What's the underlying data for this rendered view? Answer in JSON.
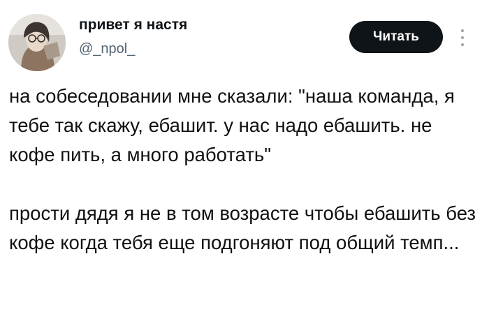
{
  "author": {
    "display_name": "привет я настя",
    "handle": "@_npol_"
  },
  "actions": {
    "read_label": "Читать",
    "more_icon": "more-vertical-icon"
  },
  "tweet": {
    "paragraphs": [
      "на собеседовании мне сказали: \"наша команда, я тебе так скажу, ебашит. у нас надо ебашить. не кофе пить, а много работать\"",
      "прости дядя я не в том возрасте чтобы ебашить без кофе когда тебя еще подгоняют под общий темп..."
    ]
  },
  "colors": {
    "button_bg": "#0f1419",
    "handle": "#536471"
  }
}
